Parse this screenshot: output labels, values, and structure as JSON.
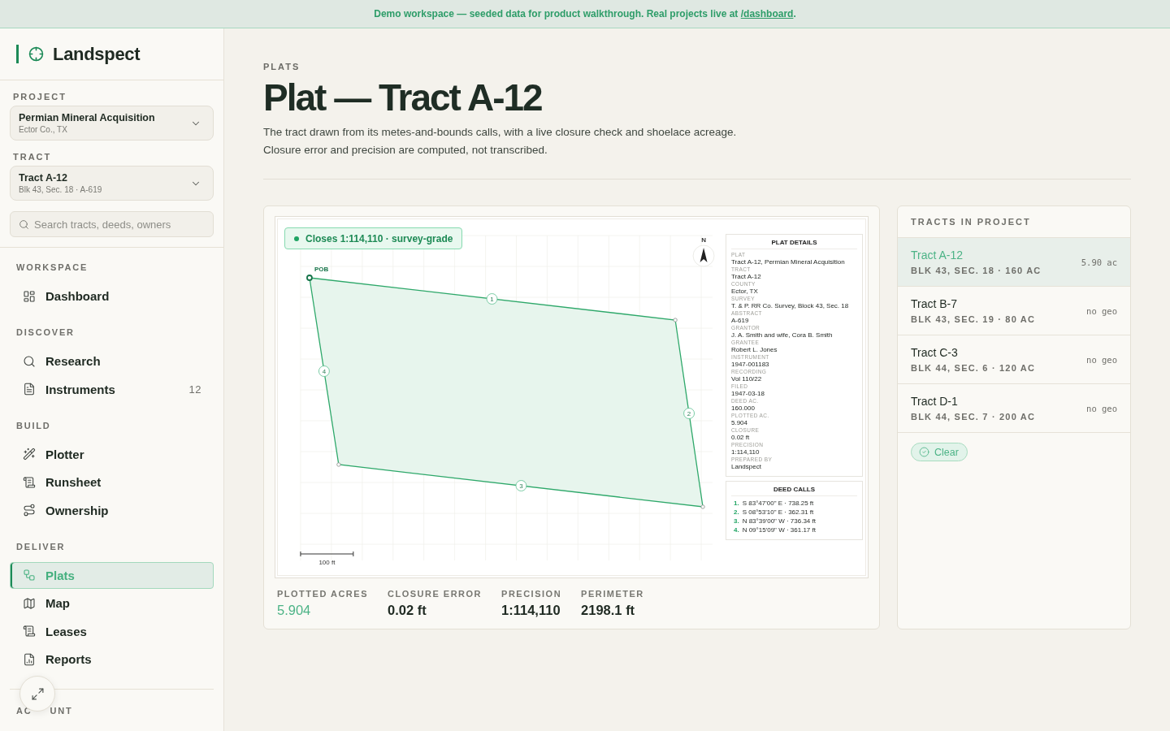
{
  "banner": {
    "text": "Demo workspace — seeded data for product walkthrough. Real projects live at",
    "link": "/dashboard",
    "trailing": "."
  },
  "sidebar": {
    "brand": "Landspect",
    "project": {
      "label": "PROJECT",
      "value": "Permian Mineral Acquisition",
      "detail": "Ector Co., TX"
    },
    "tract": {
      "label": "TRACT",
      "value": "Tract A-12",
      "detail": "Blk 43, Sec. 18 · A-619"
    },
    "search": {
      "placeholder": "Search tracts, deeds, owners"
    },
    "sections": [
      {
        "label": "WORKSPACE",
        "items": [
          {
            "label": "Dashboard",
            "selected": false
          }
        ]
      },
      {
        "label": "DISCOVER",
        "items": [
          {
            "label": "Research",
            "selected": false
          },
          {
            "label": "Instruments",
            "count": "12",
            "selected": false
          }
        ]
      },
      {
        "label": "BUILD",
        "items": [
          {
            "label": "Plotter",
            "selected": false
          },
          {
            "label": "Runsheet",
            "selected": false
          },
          {
            "label": "Ownership",
            "selected": false
          }
        ]
      },
      {
        "label": "DELIVER",
        "items": [
          {
            "label": "Plats",
            "selected": true
          },
          {
            "label": "Map",
            "selected": false
          },
          {
            "label": "Leases",
            "selected": false
          },
          {
            "label": "Reports",
            "selected": false
          }
        ]
      }
    ],
    "account_section": {
      "label_parts": [
        "AC",
        "UNT"
      ]
    }
  },
  "main": {
    "eyebrow": "PLATS",
    "title": "Plat — Tract A-12",
    "description": [
      "The tract drawn from its metes-and-bounds calls, with a live closure check and shoelace acreage.",
      "Closure error and precision are computed, not transcribed."
    ],
    "plat": {
      "status": "Closes 1:114,110 · survey-grade",
      "pob_label": "POB",
      "edge_markers": [
        "1",
        "2",
        "3",
        "4"
      ],
      "north_label": "N",
      "scale_label": "100 ft",
      "details_title": "PLAT DETAILS",
      "details": [
        {
          "label": "PLAT",
          "value": "Tract A-12, Permian Mineral Acquisition"
        },
        {
          "label": "TRACT",
          "value": "Tract A-12"
        },
        {
          "label": "COUNTY",
          "value": "Ector, TX"
        },
        {
          "label": "SURVEY",
          "value": "T. & P. RR Co. Survey, Block 43, Sec. 18"
        },
        {
          "label": "ABSTRACT",
          "value": "A-619"
        },
        {
          "label": "GRANTOR",
          "value": "J. A. Smith and wife, Cora B. Smith"
        },
        {
          "label": "GRANTEE",
          "value": "Robert L. Jones"
        },
        {
          "label": "INSTRUMENT",
          "value": "1947-001183"
        },
        {
          "label": "RECORDING",
          "value": "Vol 110/22"
        },
        {
          "label": "FILED",
          "value": "1947-03-18"
        },
        {
          "label": "DEED AC.",
          "value": "160.000"
        },
        {
          "label": "PLOTTED AC.",
          "value": "5.904"
        },
        {
          "label": "CLOSURE",
          "value": "0.02 ft"
        },
        {
          "label": "PRECISION",
          "value": "1:114,110"
        },
        {
          "label": "PREPARED BY",
          "value": "Landspect"
        }
      ],
      "calls_title": "DEED CALLS",
      "deed_calls": [
        {
          "number": "1.",
          "call": "S 83°47'00\" E · 738.25 ft"
        },
        {
          "number": "2.",
          "call": "S 08°53'10\" E · 362.31 ft"
        },
        {
          "number": "3.",
          "call": "N 83°39'00\" W · 736.34 ft"
        },
        {
          "number": "4.",
          "call": "N 09°15'09\" W · 361.17 ft"
        }
      ]
    },
    "stats": [
      {
        "label": "PLOTTED ACRES",
        "value": "5.904",
        "highlighted": true
      },
      {
        "label": "CLOSURE ERROR",
        "value": "0.02 ft",
        "highlighted": false
      },
      {
        "label": "PRECISION",
        "value": "1:114,110",
        "highlighted": false
      },
      {
        "label": "PERIMETER",
        "value": "2198.1 ft",
        "highlighted": false
      }
    ],
    "tracts_panel": {
      "title": "TRACTS IN PROJECT",
      "tracts": [
        {
          "name": "Tract A-12",
          "detail": "BLK 43, SEC. 18 · 160 AC",
          "reading": "5.90 ac",
          "selected": true
        },
        {
          "name": "Tract B-7",
          "detail": "BLK 43, SEC. 19 · 80 AC",
          "reading": "no geo",
          "selected": false
        },
        {
          "name": "Tract C-3",
          "detail": "BLK 44, SEC. 6 · 120 AC",
          "reading": "no geo",
          "selected": false
        },
        {
          "name": "Tract D-1",
          "detail": "BLK 44, SEC. 7 · 200 AC",
          "reading": "no geo",
          "selected": false
        }
      ],
      "clear_label": "Clear"
    }
  }
}
